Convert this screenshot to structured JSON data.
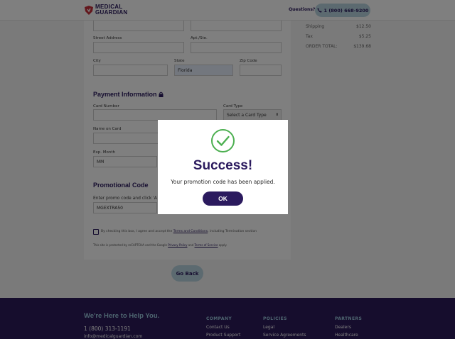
{
  "header": {
    "logo_line1": "MEDICAL",
    "logo_line2": "GUARDIAN",
    "questions_label": "Questions?",
    "phone": "1 (800) 668-9200"
  },
  "summary": {
    "rows": [
      {
        "label": "Shipping",
        "value": "$12.50"
      },
      {
        "label": "Tax",
        "value": "$5.25"
      },
      {
        "label": "ORDER TOTAL:",
        "value": "$139.68"
      }
    ]
  },
  "form": {
    "street_label": "Street Address",
    "apt_label": "Apt./Ste.",
    "city_label": "City",
    "state_label": "State",
    "state_value": "Florida",
    "zip_label": "Zip Code",
    "payment_title": "Payment Information",
    "card_number_label": "Card Number",
    "card_type_label": "Card Type",
    "card_type_value": "Select a Card Type",
    "name_on_card_label": "Name on Card",
    "exp_month_label": "Exp. Month",
    "exp_month_value": "MM",
    "promo_title": "Promotional Code",
    "promo_hint": "Enter promo code and click 'A",
    "promo_value": "MGEXTRA50",
    "terms_pre": "By checking this box, I agree and accept the ",
    "terms_link": "Terms and Conditions",
    "terms_post": ", including Termination section",
    "recaptcha_pre": "This site is protected by reCAPTCHA and the Google ",
    "privacy_link": "Privacy Policy",
    "recaptcha_mid": " and ",
    "tos_link": "Terms of Service",
    "recaptcha_post": " apply.",
    "back_label": "Go Back"
  },
  "modal": {
    "title": "Success!",
    "message": "Your promotion code has been applied.",
    "ok_label": "OK"
  },
  "footer": {
    "help_title": "We're Here to Help You.",
    "phone": "1 (800) 313-1191",
    "email": "info@medicalguardian.com",
    "company_head": "COMPANY",
    "company_links": [
      "Contact Us",
      "Product Support"
    ],
    "policies_head": "POLICIES",
    "policies_links": [
      "Legal",
      "Service Agreements"
    ],
    "partners_head": "PARTNERS",
    "partners_links": [
      "Dealers",
      "Healthcare"
    ]
  },
  "colors": {
    "brand_purple": "#2b1a5e",
    "accent_blue": "#b8d4e0",
    "success_green": "#4caf50",
    "logo_red": "#c62f3a"
  },
  "icons": [
    "shield-logo-icon",
    "phone-icon",
    "lock-icon",
    "checkmark-circle-icon",
    "checkbox-icon",
    "select-arrows-icon"
  ]
}
